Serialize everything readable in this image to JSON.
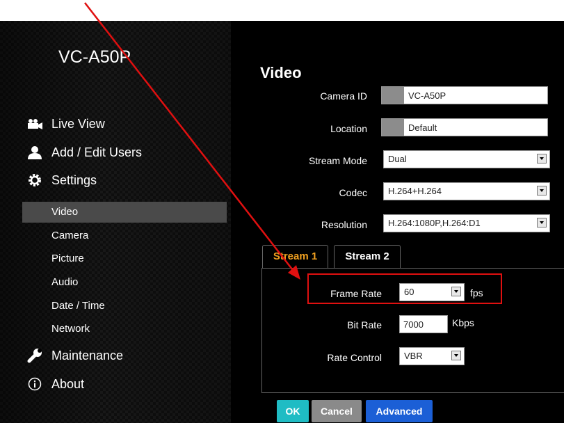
{
  "top_caption": {
    "text": "                              .  ",
    "link": "http://"
  },
  "sidebar": {
    "model": "VC-A50P",
    "nav": [
      {
        "label": "Live View",
        "icon": "camera-icon"
      },
      {
        "label": "Add / Edit Users",
        "icon": "user-icon"
      },
      {
        "label": "Settings",
        "icon": "gear-icon"
      }
    ],
    "settings_items": [
      "Video",
      "Camera",
      "Picture",
      "Audio",
      "Date / Time",
      "Network"
    ],
    "active_item": "Video",
    "bottom_nav": [
      {
        "label": "Maintenance",
        "icon": "wrench-icon"
      },
      {
        "label": "About",
        "icon": "info-icon"
      }
    ]
  },
  "page": {
    "title": "Video",
    "camera_id": {
      "label": "Camera ID",
      "value": "VC-A50P"
    },
    "location": {
      "label": "Location",
      "value": "Default"
    },
    "stream_mode": {
      "label": "Stream Mode",
      "value": "Dual"
    },
    "codec": {
      "label": "Codec",
      "value": "H.264+H.264"
    },
    "resolution": {
      "label": "Resolution",
      "value": "H.264:1080P,H.264:D1"
    }
  },
  "tabs": [
    "Stream 1",
    "Stream 2"
  ],
  "active_tab": "Stream 1",
  "stream": {
    "frame_rate": {
      "label": "Frame Rate",
      "value": "60",
      "unit": "fps"
    },
    "bit_rate": {
      "label": "Bit Rate",
      "value": "7000",
      "unit": "Kbps"
    },
    "rate_control": {
      "label": "Rate Control",
      "value": "VBR"
    }
  },
  "buttons": {
    "ok": "OK",
    "cancel": "Cancel",
    "advanced": "Advanced"
  },
  "colors": {
    "ok": "#1fbcc4",
    "cancel": "#8a8a8a",
    "advanced": "#1b5fd6",
    "highlight": "#e01010",
    "active_tab": "#f0a020"
  }
}
